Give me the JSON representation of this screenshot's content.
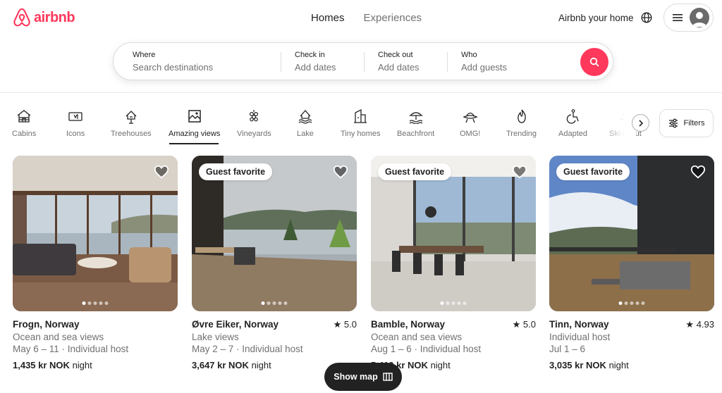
{
  "brand": {
    "name": "airbnb",
    "color": "#ff385c"
  },
  "nav": {
    "tabs": [
      "Homes",
      "Experiences"
    ],
    "active": "Homes"
  },
  "header": {
    "host_link": "Airbnb your home"
  },
  "search": {
    "where": {
      "label": "Where",
      "placeholder": "Search destinations"
    },
    "checkin": {
      "label": "Check in",
      "placeholder": "Add dates"
    },
    "checkout": {
      "label": "Check out",
      "placeholder": "Add dates"
    },
    "who": {
      "label": "Who",
      "placeholder": "Add guests"
    }
  },
  "categories": [
    {
      "label": "Cabins",
      "icon": "cabin-icon"
    },
    {
      "label": "Icons",
      "icon": "ticket-icon"
    },
    {
      "label": "Treehouses",
      "icon": "treehouse-icon"
    },
    {
      "label": "Amazing views",
      "icon": "picture-icon",
      "active": true
    },
    {
      "label": "Vineyards",
      "icon": "grapes-icon"
    },
    {
      "label": "Lake",
      "icon": "lake-icon"
    },
    {
      "label": "Tiny homes",
      "icon": "tiny-home-icon"
    },
    {
      "label": "Beachfront",
      "icon": "beach-icon"
    },
    {
      "label": "OMG!",
      "icon": "ufo-house-icon"
    },
    {
      "label": "Trending",
      "icon": "flame-icon"
    },
    {
      "label": "Adapted",
      "icon": "wheelchair-icon"
    },
    {
      "label": "Ski-in/out",
      "icon": "ski-icon"
    }
  ],
  "filters_label": "Filters",
  "listings": [
    {
      "title": "Frogn, Norway",
      "rating": "",
      "subtitle": "Ocean and sea views",
      "dates": "May 6 – 11 · Individual host",
      "price": "1,435 kr NOK",
      "price_unit": "night",
      "badge": ""
    },
    {
      "title": "Øvre Eiker, Norway",
      "rating": "5.0",
      "subtitle": "Lake views",
      "dates": "May 2 – 7 · Individual host",
      "price": "3,647 kr NOK",
      "price_unit": "night",
      "badge": "Guest favorite"
    },
    {
      "title": "Bamble, Norway",
      "rating": "5.0",
      "subtitle": "Ocean and sea views",
      "dates": "Aug 1 – 6 · Individual host",
      "price": "5,410 kr NOK",
      "price_unit": "night",
      "badge": "Guest favorite"
    },
    {
      "title": "Tinn, Norway",
      "rating": "4.93",
      "subtitle": "Individual host",
      "dates": "Jul 1 – 6",
      "price": "3,035 kr NOK",
      "price_unit": "night",
      "badge": "Guest favorite"
    }
  ],
  "show_map_label": "Show map"
}
